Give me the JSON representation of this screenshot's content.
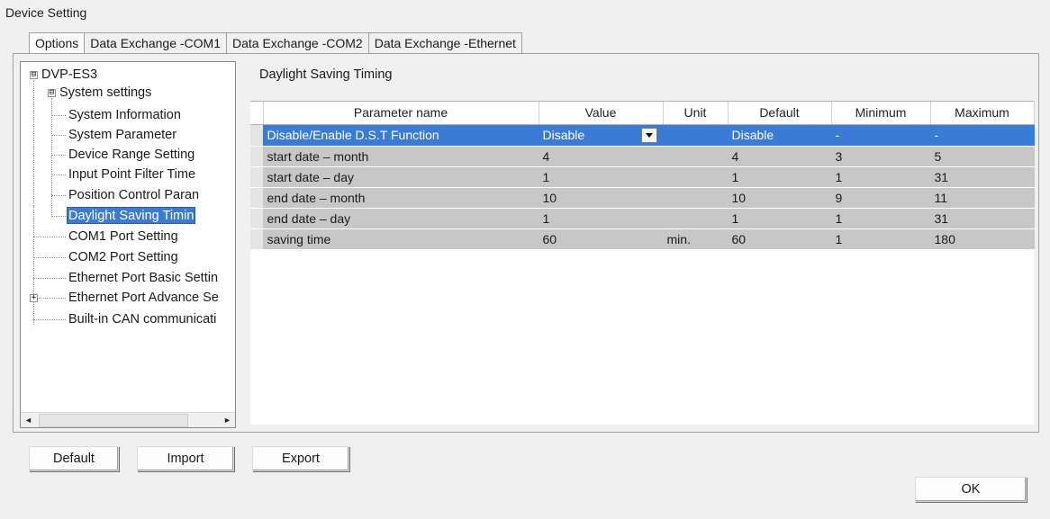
{
  "window": {
    "title": "Device Setting"
  },
  "tabs": [
    {
      "label": "Options",
      "active": true
    },
    {
      "label": "Data Exchange -COM1",
      "active": false
    },
    {
      "label": "Data Exchange -COM2",
      "active": false
    },
    {
      "label": "Data Exchange -Ethernet",
      "active": false
    }
  ],
  "tree": {
    "root": {
      "label": "DVP-ES3",
      "expander": "⊟"
    },
    "system_settings": {
      "label": "System settings",
      "expander": "⊟"
    },
    "system_children": [
      {
        "label": "System Information"
      },
      {
        "label": "System Parameter"
      },
      {
        "label": "Device Range Setting"
      },
      {
        "label": "Input Point Filter Time"
      },
      {
        "label": "Position Control Paran"
      },
      {
        "label": "Daylight Saving Timin",
        "selected": true
      }
    ],
    "root_children": [
      {
        "label": "COM1 Port Setting"
      },
      {
        "label": "COM2 Port Setting"
      },
      {
        "label": "Ethernet Port Basic Settin"
      },
      {
        "label": "Ethernet Port Advance Se",
        "expander": "+"
      },
      {
        "label": "Built-in CAN communicati"
      }
    ],
    "scroll_left_icon": "◄",
    "scroll_right_icon": "►"
  },
  "section": {
    "title": "Daylight Saving Timing"
  },
  "grid": {
    "columns": [
      "Parameter name",
      "Value",
      "Unit",
      "Default",
      "Minimum",
      "Maximum"
    ],
    "rows": [
      [
        "Disable/Enable D.S.T Function",
        "Disable",
        "",
        "Disable",
        "-",
        "-"
      ],
      [
        "start date – month",
        "4",
        "",
        "4",
        "3",
        "5"
      ],
      [
        "start date – day",
        "1",
        "",
        "1",
        "1",
        "31"
      ],
      [
        "end date – month",
        "10",
        "",
        "10",
        "9",
        "11"
      ],
      [
        "end date – day",
        "1",
        "",
        "1",
        "1",
        "31"
      ],
      [
        "saving time",
        "60",
        "min.",
        "60",
        "1",
        "180"
      ]
    ],
    "selected_row": 0,
    "selection_color": "#3a7bd5"
  },
  "buttons": {
    "default_label": "Default",
    "import_label": "Import",
    "export_label": "Export",
    "ok_label": "OK"
  }
}
